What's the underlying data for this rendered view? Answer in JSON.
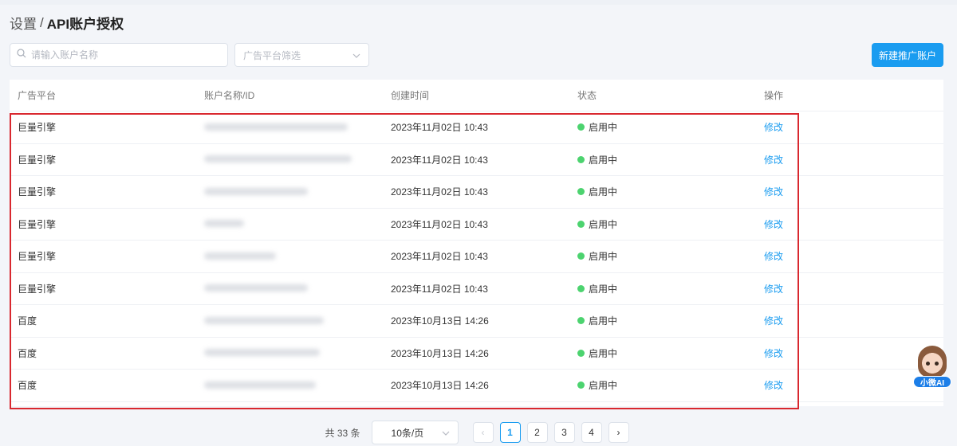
{
  "breadcrumb": {
    "parent": "设置",
    "separator": "/",
    "current": "API账户授权"
  },
  "search": {
    "placeholder": "请输入账户名称",
    "value": ""
  },
  "platform_filter": {
    "placeholder": "广告平台筛选"
  },
  "new_button": {
    "label": "新建推广账户"
  },
  "table": {
    "headers": [
      "广告平台",
      "账户名称/ID",
      "创建时间",
      "状态",
      "操作"
    ],
    "rows": [
      {
        "platform": "巨量引擎",
        "created": "2023年11月02日 10:43",
        "status": "启用中",
        "action": "修改"
      },
      {
        "platform": "巨量引擎",
        "created": "2023年11月02日 10:43",
        "status": "启用中",
        "action": "修改"
      },
      {
        "platform": "巨量引擎",
        "created": "2023年11月02日 10:43",
        "status": "启用中",
        "action": "修改"
      },
      {
        "platform": "巨量引擎",
        "created": "2023年11月02日 10:43",
        "status": "启用中",
        "action": "修改"
      },
      {
        "platform": "巨量引擎",
        "created": "2023年11月02日 10:43",
        "status": "启用中",
        "action": "修改"
      },
      {
        "platform": "巨量引擎",
        "created": "2023年11月02日 10:43",
        "status": "启用中",
        "action": "修改"
      },
      {
        "platform": "百度",
        "created": "2023年10月13日 14:26",
        "status": "启用中",
        "action": "修改"
      },
      {
        "platform": "百度",
        "created": "2023年10月13日 14:26",
        "status": "启用中",
        "action": "修改"
      },
      {
        "platform": "百度",
        "created": "2023年10月13日 14:26",
        "status": "启用中",
        "action": "修改"
      }
    ]
  },
  "pagination": {
    "total_text": "共 33 条",
    "page_size": "10条/页",
    "prev": "‹",
    "next": "›",
    "pages": [
      "1",
      "2",
      "3",
      "4"
    ],
    "current_page": "1"
  },
  "assistant": {
    "label": "小微AI"
  },
  "colors": {
    "accent": "#1a9cf0",
    "status_active": "#4cd36f",
    "highlight_border": "#d9282f"
  },
  "icons": {
    "search": "search-icon",
    "dropdown": "chevron-down-icon"
  }
}
